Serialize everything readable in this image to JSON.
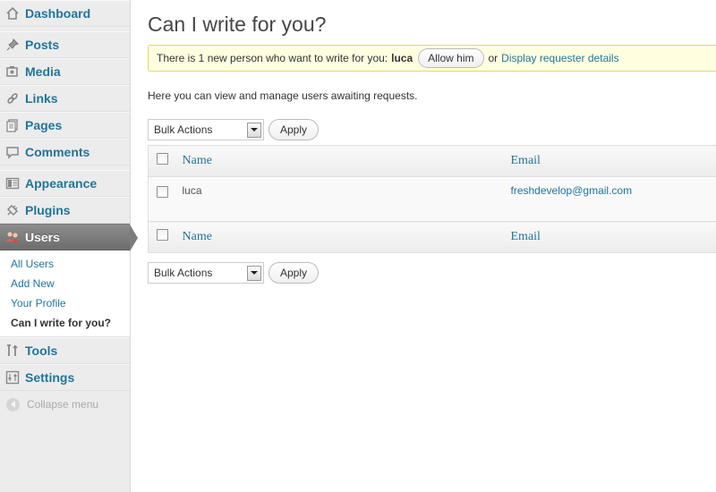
{
  "sidebar": {
    "items": [
      {
        "label": "Dashboard",
        "icon": "dashboard-icon"
      },
      {
        "label": "Posts",
        "icon": "pin-icon"
      },
      {
        "label": "Media",
        "icon": "media-icon"
      },
      {
        "label": "Links",
        "icon": "link-icon"
      },
      {
        "label": "Pages",
        "icon": "pages-icon"
      },
      {
        "label": "Comments",
        "icon": "comment-icon"
      },
      {
        "label": "Appearance",
        "icon": "appearance-icon"
      },
      {
        "label": "Plugins",
        "icon": "plugin-icon"
      },
      {
        "label": "Users",
        "icon": "users-icon"
      },
      {
        "label": "Tools",
        "icon": "tools-icon"
      },
      {
        "label": "Settings",
        "icon": "settings-icon"
      }
    ],
    "users_submenu": [
      "All Users",
      "Add New",
      "Your Profile",
      "Can I write for you?"
    ],
    "collapse_label": "Collapse menu"
  },
  "page": {
    "title": "Can I write for you?",
    "notice": {
      "text": "There is 1 new person who want to write for you:",
      "username": "luca",
      "allow_button": "Allow him",
      "or_text": "or",
      "details_link": "Display requester details"
    },
    "intro": "Here you can view and manage users awaiting requests.",
    "bulk_actions": "Bulk Actions",
    "apply_button": "Apply",
    "table": {
      "columns": [
        "Name",
        "Email"
      ],
      "rows": [
        {
          "name": "luca",
          "email": "freshdevelop@gmail.com"
        }
      ]
    }
  },
  "colors": {
    "link": "#21759b",
    "notice_bg": "#ffffe0",
    "notice_border": "#e6db55",
    "current_menu": "#7d7d7d"
  }
}
